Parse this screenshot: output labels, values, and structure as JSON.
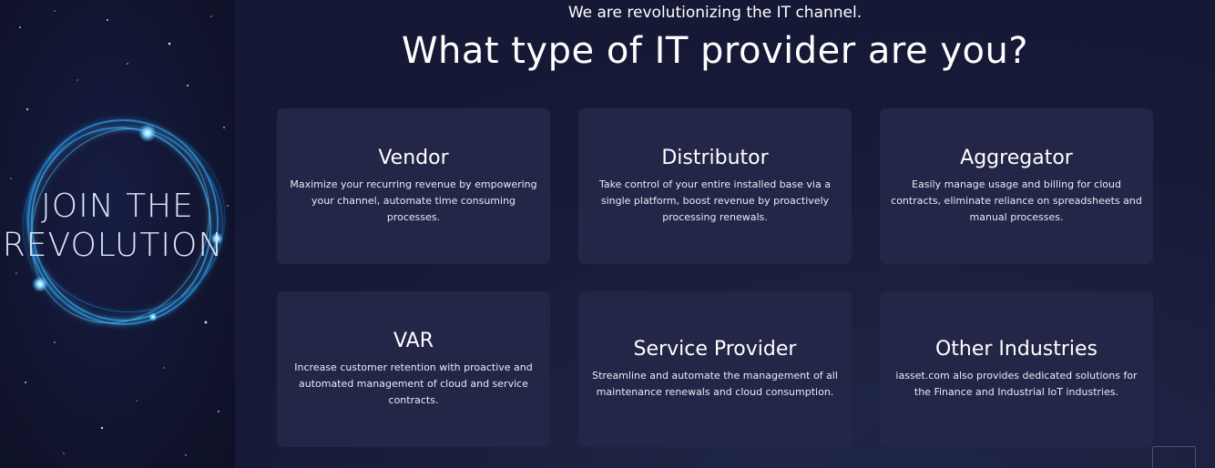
{
  "promo": {
    "line1": "JOIN THE",
    "line2": "REVOLUTION"
  },
  "header": {
    "subtitle": "We are revolutionizing the IT channel.",
    "title": "What type of IT provider are you?"
  },
  "cards": [
    {
      "title": "Vendor",
      "description": "Maximize your recurring revenue by empowering your channel, automate time consuming processes."
    },
    {
      "title": "Distributor",
      "description": "Take control of your entire installed base via a single platform, boost revenue by proactively processing renewals."
    },
    {
      "title": "Aggregator",
      "description": "Easily manage usage and billing for cloud contracts, eliminate reliance on spreadsheets and manual processes."
    },
    {
      "title": "VAR",
      "description": "Increase customer retention with proactive and automated management of cloud and service contracts."
    },
    {
      "title": "Service Provider",
      "description": "Streamline and automate the management of all maintenance renewals and cloud consumption."
    },
    {
      "title": "Other Industries",
      "description": "iasset.com also provides dedicated solutions for the Finance and Industrial IoT industries."
    }
  ],
  "colors": {
    "background": "#141834",
    "card": "#232647",
    "ring_glow": "#3fb6ff"
  },
  "icons": {
    "scroll_top": "back-to-top-icon"
  }
}
